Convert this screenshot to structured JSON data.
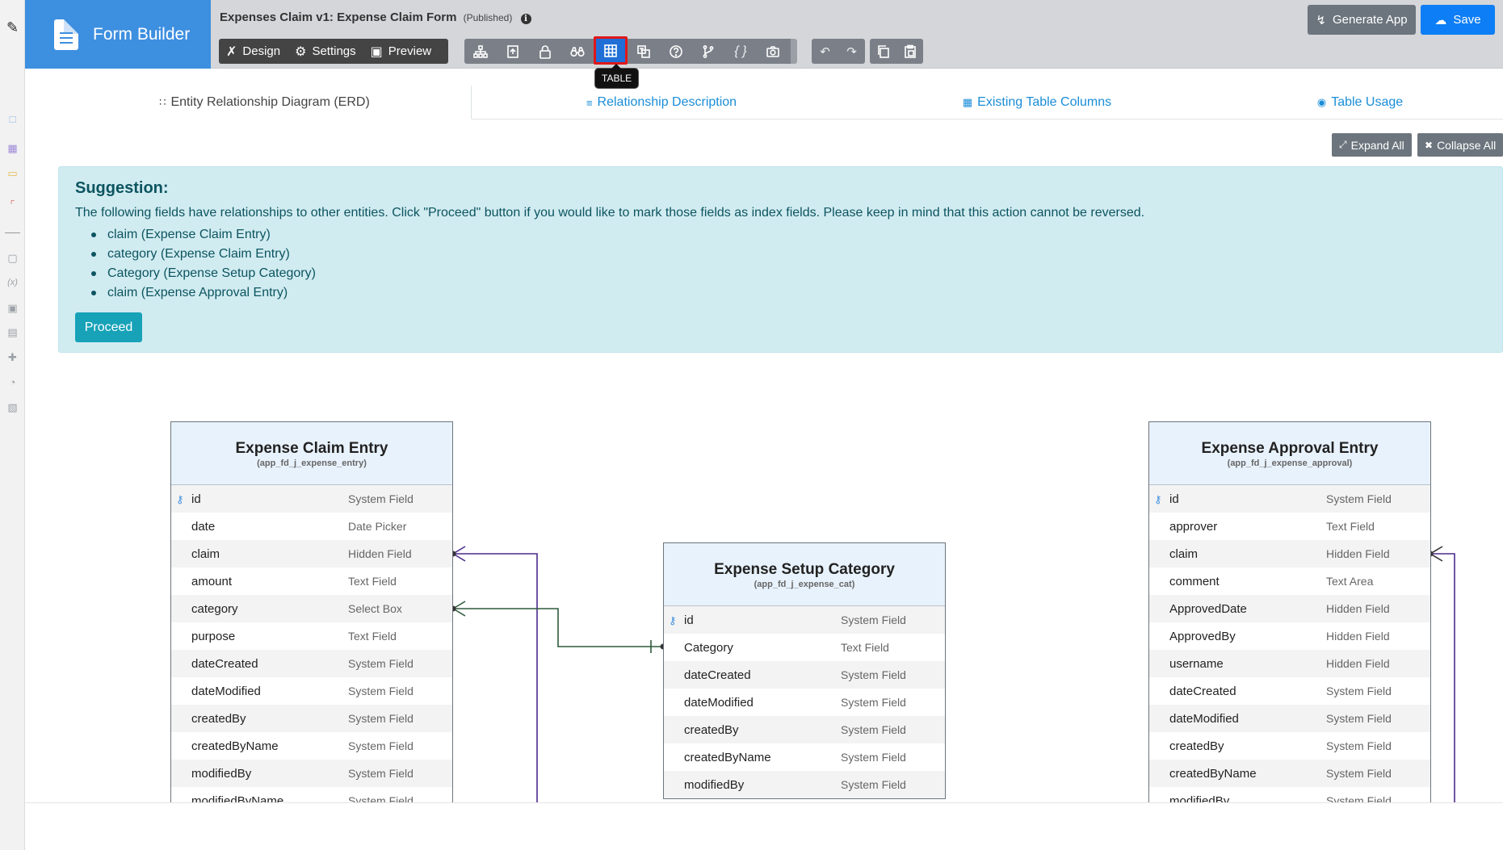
{
  "brand": {
    "title": "Form Builder"
  },
  "header": {
    "form_title": "Expenses Claim v1: Expense Claim Form",
    "status": "(Published)",
    "modes": [
      {
        "label": "Design",
        "icon": "design-icon"
      },
      {
        "label": "Settings",
        "icon": "gear-icon"
      },
      {
        "label": "Preview",
        "icon": "preview-icon"
      }
    ],
    "generate_label": "Generate App",
    "save_label": "Save",
    "tooltip": "TABLE"
  },
  "tabs": [
    {
      "label": "Entity Relationship Diagram (ERD)",
      "icon": "erd-icon",
      "active": true
    },
    {
      "label": "Relationship Description",
      "icon": "list-icon",
      "active": false
    },
    {
      "label": "Existing Table Columns",
      "icon": "table-icon",
      "active": false
    },
    {
      "label": "Table Usage",
      "icon": "binoculars-icon",
      "active": false
    }
  ],
  "controls": {
    "expand_all": "Expand All",
    "collapse_all": "Collapse All"
  },
  "suggestion": {
    "title": "Suggestion:",
    "text": "The following fields have relationships to other entities. Click \"Proceed\" button if you would like to mark those fields as index fields. Please keep in mind that this action cannot be reversed.",
    "items": [
      "claim (Expense Claim Entry)",
      "category (Expense Claim Entry)",
      "Category (Expense Setup Category)",
      "claim (Expense Approval Entry)"
    ],
    "proceed_label": "Proceed"
  },
  "entities": {
    "claim_entry": {
      "name": "Expense Claim Entry",
      "table": "(app_fd_j_expense_entry)",
      "fields": [
        {
          "name": "id",
          "type": "System Field"
        },
        {
          "name": "date",
          "type": "Date Picker"
        },
        {
          "name": "claim",
          "type": "Hidden Field"
        },
        {
          "name": "amount",
          "type": "Text Field"
        },
        {
          "name": "category",
          "type": "Select Box"
        },
        {
          "name": "purpose",
          "type": "Text Field"
        },
        {
          "name": "dateCreated",
          "type": "System Field"
        },
        {
          "name": "dateModified",
          "type": "System Field"
        },
        {
          "name": "createdBy",
          "type": "System Field"
        },
        {
          "name": "createdByName",
          "type": "System Field"
        },
        {
          "name": "modifiedBy",
          "type": "System Field"
        },
        {
          "name": "modifiedByName",
          "type": "System Field"
        }
      ]
    },
    "setup_category": {
      "name": "Expense Setup Category",
      "table": "(app_fd_j_expense_cat)",
      "fields": [
        {
          "name": "id",
          "type": "System Field"
        },
        {
          "name": "Category",
          "type": "Text Field"
        },
        {
          "name": "dateCreated",
          "type": "System Field"
        },
        {
          "name": "dateModified",
          "type": "System Field"
        },
        {
          "name": "createdBy",
          "type": "System Field"
        },
        {
          "name": "createdByName",
          "type": "System Field"
        },
        {
          "name": "modifiedBy",
          "type": "System Field"
        }
      ]
    },
    "approval_entry": {
      "name": "Expense Approval Entry",
      "table": "(app_fd_j_expense_approval)",
      "fields": [
        {
          "name": "id",
          "type": "System Field"
        },
        {
          "name": "approver",
          "type": "Text Field"
        },
        {
          "name": "claim",
          "type": "Hidden Field"
        },
        {
          "name": "comment",
          "type": "Text Area"
        },
        {
          "name": "ApprovedDate",
          "type": "Hidden Field"
        },
        {
          "name": "ApprovedBy",
          "type": "Hidden Field"
        },
        {
          "name": "username",
          "type": "Hidden Field"
        },
        {
          "name": "dateCreated",
          "type": "System Field"
        },
        {
          "name": "dateModified",
          "type": "System Field"
        },
        {
          "name": "createdBy",
          "type": "System Field"
        },
        {
          "name": "createdByName",
          "type": "System Field"
        },
        {
          "name": "modifiedBy",
          "type": "System Field"
        }
      ]
    }
  },
  "colors": {
    "brand": "#3d8fe0",
    "save": "#0d7ef5",
    "info_bg": "#d1ecf1",
    "proceed": "#17a2b8",
    "link_purple": "#4b2a8a",
    "link_green": "#2e5a3c"
  }
}
